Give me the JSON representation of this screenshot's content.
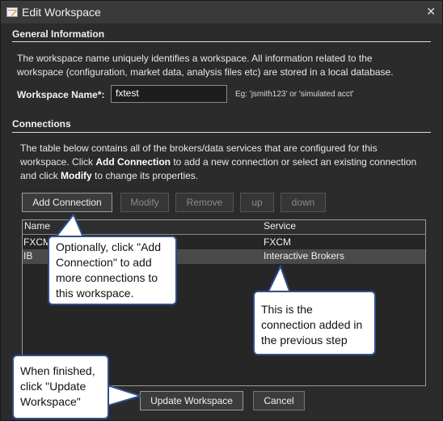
{
  "window": {
    "title": "Edit Workspace",
    "close_glyph": "✕"
  },
  "general": {
    "heading": "General Information",
    "description_lines": [
      "The workspace name uniquely identifies a workspace. All information related to the",
      "workspace (configuration, market data, analysis files etc) are stored in a local database."
    ],
    "name_label": "Workspace Name*:",
    "name_value": "fxtest",
    "hint": "Eg: 'jsmith123' or 'simulated acct'"
  },
  "connections": {
    "heading": "Connections",
    "desc_line1": "The table below contains all of the brokers/data services that are configured for this",
    "desc_line2_prefix": "workspace. Click ",
    "desc_line2_bold": "Add Connection",
    "desc_line2_suffix": " to add a new connection or select an existing connection",
    "desc_line3_prefix": "and click ",
    "desc_line3_bold": "Modify",
    "desc_line3_suffix": " to change its properties.",
    "buttons": {
      "add": "Add Connection",
      "modify": "Modify",
      "remove": "Remove",
      "up": "up",
      "down": "down"
    },
    "table": {
      "col_name": "Name",
      "col_service": "Service",
      "rows": [
        {
          "name": "FXCM",
          "service": "FXCM"
        },
        {
          "name": "IB",
          "service": "Interactive Brokers"
        }
      ]
    }
  },
  "footer": {
    "update": "Update Workspace",
    "cancel": "Cancel"
  },
  "callouts": {
    "add_connection": [
      "Optionally, click \"Add",
      "Connection\" to add",
      "more connections to",
      "this workspace."
    ],
    "connection_added": [
      "This is the",
      "connection added in",
      "the previous step"
    ],
    "when_finished": [
      "When finished,",
      "click \"Update",
      "Workspace\""
    ]
  }
}
